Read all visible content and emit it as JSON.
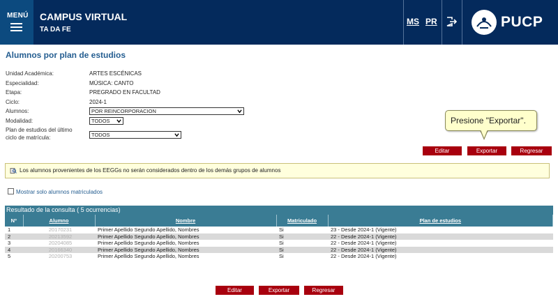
{
  "header": {
    "menu_label": "MENÚ",
    "app_title": "CAMPUS VIRTUAL",
    "app_subtitle": "TA DA FE",
    "link_ms": "MS",
    "link_pr": "PR",
    "logo_text": "PUCP",
    "colors": {
      "bar": "#042a5c",
      "menu": "#0c4a7f"
    }
  },
  "page": {
    "title": "Alumnos por plan de estudios",
    "fields": [
      {
        "label": "Unidad Académica:",
        "value": "ARTES ESCÉNICAS"
      },
      {
        "label": "Especialidad:",
        "value": "MÚSICA: CANTO"
      },
      {
        "label": "Etapa:",
        "value": "PREGRADO EN FACULTAD"
      },
      {
        "label": "Ciclo:",
        "value": "2024-1"
      }
    ],
    "alumnos": {
      "label": "Alumnos:",
      "selected": "POR REINCORPORACION"
    },
    "modalidad": {
      "label": "Modalidad:",
      "selected": "TODOS"
    },
    "plan": {
      "label_line1": "Plan de estudios del último",
      "label_line2": "ciclo de matrícula:",
      "selected": "TODOS"
    }
  },
  "tooltip": {
    "text": "Presione \"Exportar\"."
  },
  "buttons": {
    "edit": "Editar",
    "export": "Exportar",
    "back": "Regresar",
    "color": "#a8000e"
  },
  "notice": {
    "text": "Los alumnos provenientes de los EEGGs no serán considerados dentro de los demás grupos de alumnos"
  },
  "filter": {
    "label": "Mostrar solo alumnos matriculados",
    "checked": false
  },
  "results": {
    "caption": "Resultado de la consulta ( 5 ocurrencias)",
    "columns": [
      "Nº",
      "Alumno",
      "Nombre",
      "Matriculado",
      "Plan de estudios"
    ],
    "rows": [
      {
        "n": "1",
        "code": "20170231",
        "name": "Primer Apellido Segundo Apellido, Nombres",
        "enrolled": "Si",
        "plan": "23 - Desde 2024-1 (Vigente)"
      },
      {
        "n": "2",
        "code": "20213592",
        "name": "Primer Apellido Segundo Apellido, Nombres",
        "enrolled": "Si",
        "plan": "22 - Desde 2024-1 (Vigente)"
      },
      {
        "n": "3",
        "code": "20204085",
        "name": "Primer Apellido Segundo Apellido, Nombres",
        "enrolled": "Si",
        "plan": "22 - Desde 2024-1 (Vigente)"
      },
      {
        "n": "4",
        "code": "20166340",
        "name": "Primer Apellido Segundo Apellido, Nombres",
        "enrolled": "Si",
        "plan": "22 - Desde 2024-1 (Vigente)"
      },
      {
        "n": "5",
        "code": "20200753",
        "name": "Primer Apellido Segundo Apellido, Nombres",
        "enrolled": "Si",
        "plan": "22 - Desde 2024-1 (Vigente)"
      }
    ]
  }
}
